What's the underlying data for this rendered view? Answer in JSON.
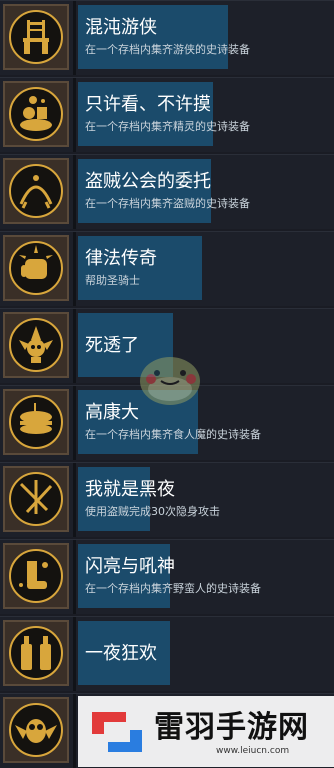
{
  "achievements": [
    {
      "title": "混沌游侠",
      "desc": "在一个存档内集齐游侠的史诗装备",
      "icon": "chair-icon"
    },
    {
      "title": "只许看、不许摸",
      "desc": "在一个存档内集齐精灵的史诗装备",
      "icon": "treasure-pile-icon"
    },
    {
      "title": "盗贼公会的委托",
      "desc": "在一个存档内集齐盗贼的史诗装备",
      "icon": "crown-claw-icon"
    },
    {
      "title": "律法传奇",
      "desc": "帮助圣骑士",
      "icon": "fist-icon"
    },
    {
      "title": "死透了",
      "desc": "",
      "icon": "jester-skull-icon"
    },
    {
      "title": "高康大",
      "desc": "在一个存档内集齐食人魔的史诗装备",
      "icon": "sandwich-icon"
    },
    {
      "title": "我就是黑夜",
      "desc": "使用盗贼完成30次隐身攻击",
      "icon": "daggers-icon"
    },
    {
      "title": "闪亮与吼神",
      "desc": "在一个存档内集齐野蛮人的史诗装备",
      "icon": "boots-icon"
    },
    {
      "title": "一夜狂欢",
      "desc": "",
      "icon": "bottles-icon"
    },
    {
      "title": "",
      "desc": "",
      "icon": "owl-icon"
    }
  ],
  "watermark": {
    "title": "雷羽手游网",
    "url": "www.leiucn.com"
  },
  "colors": {
    "panel": "#1b4b6b",
    "gold": "#d8a63c",
    "background": "#1a1c24"
  }
}
